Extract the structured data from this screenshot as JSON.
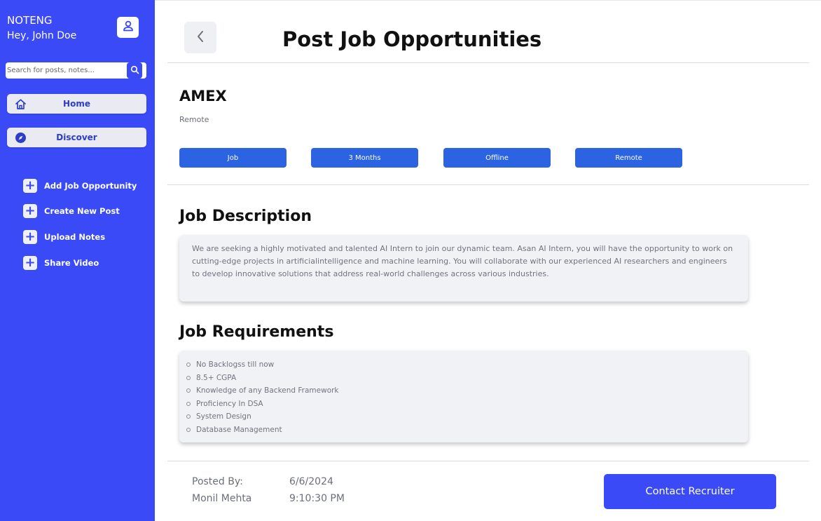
{
  "sidebar": {
    "brand": "NOTENG",
    "greeting": "Hey, John Doe",
    "search_placeholder": "Search for posts, notes...",
    "nav": [
      {
        "label": "Home",
        "icon": "home-icon"
      },
      {
        "label": "Discover",
        "icon": "compass-icon"
      }
    ],
    "actions": [
      {
        "label": "Add Job Opportunity",
        "icon": "plus-icon"
      },
      {
        "label": "Create New Post",
        "icon": "plus-icon"
      },
      {
        "label": "Upload Notes",
        "icon": "plus-icon"
      },
      {
        "label": "Share Video",
        "icon": "plus-icon"
      }
    ],
    "plus_glyph": "+"
  },
  "header": {
    "title": "Post Job Opportunities"
  },
  "job": {
    "company": "AMEX",
    "location": "Remote",
    "tags": [
      "Job",
      "3 Months",
      "Offline",
      "Remote"
    ]
  },
  "description": {
    "title": "Job Description",
    "text": "We are seeking a highly motivated and talented AI Intern to join our dynamic team. Asan AI Intern, you will have the opportunity to work on cutting-edge projects in artificialintelligence and machine learning. You will collaborate with our experienced AI researchers and engineers to develop innovative solutions that address real-world challenges across various industries."
  },
  "requirements": {
    "title": "Job Requirements",
    "items": [
      "No Backlogss till now",
      "8.5+ CGPA",
      "Knowledge of any Backend Framework",
      "Proficiency In DSA",
      "System Design",
      "Database Management"
    ]
  },
  "footer": {
    "posted_by_label": "Posted By:",
    "poster_name": "Monil Mehta",
    "date": "6/6/2024",
    "time": "9:10:30 PM",
    "contact_label": "Contact Recruiter"
  },
  "colors": {
    "sidebar_bg": "#3a4af6",
    "tag_bg": "#2b63e3",
    "button_bg": "#3a4af6"
  }
}
